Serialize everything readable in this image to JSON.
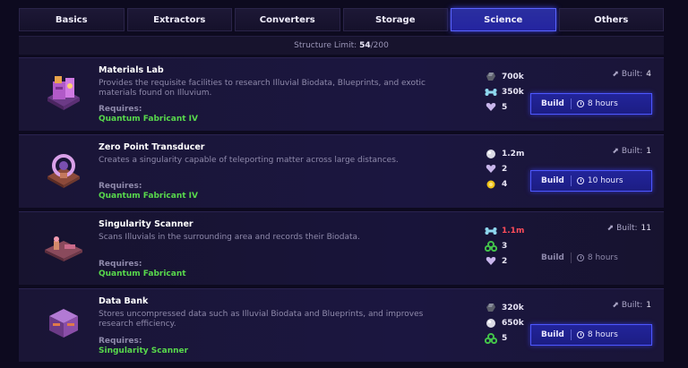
{
  "tabs": [
    {
      "label": "Basics",
      "active": false
    },
    {
      "label": "Extractors",
      "active": false
    },
    {
      "label": "Converters",
      "active": false
    },
    {
      "label": "Storage",
      "active": false
    },
    {
      "label": "Science",
      "active": true
    },
    {
      "label": "Others",
      "active": false
    }
  ],
  "limit": {
    "label": "Structure Limit:",
    "current": "54",
    "max": "/200"
  },
  "colors": {
    "accent": "#4d57ff",
    "requires_value": "#58d84c",
    "insufficient": "#ff4d5a"
  },
  "structures": [
    {
      "title": "Materials Lab",
      "icon": "materials-lab-icon",
      "description": "Provides the requisite facilities to research Illuvial Biodata, Blueprints, and exotic materials found on Illuvium.",
      "requires_label": "Requires:",
      "requires": "Quantum Fabricant IV",
      "costs": [
        {
          "icon": "ore-icon",
          "value": "700k"
        },
        {
          "icon": "bone-icon",
          "value": "350k"
        },
        {
          "icon": "heart-crystal-icon",
          "value": "5"
        }
      ],
      "built_label": "Built:",
      "built": "4",
      "build_label": "Build",
      "time": "8 hours",
      "enabled": true
    },
    {
      "title": "Zero Point Transducer",
      "icon": "transducer-icon",
      "description": "Creates a singularity capable of teleporting matter across large distances.",
      "requires_label": "Requires:",
      "requires": "Quantum Fabricant IV",
      "costs": [
        {
          "icon": "sphere-icon",
          "value": "1.2m"
        },
        {
          "icon": "heart-crystal-icon",
          "value": "2"
        },
        {
          "icon": "gold-coin-icon",
          "value": "4"
        }
      ],
      "built_label": "Built:",
      "built": "1",
      "build_label": "Build",
      "time": "10 hours",
      "enabled": true
    },
    {
      "title": "Singularity Scanner",
      "icon": "scanner-icon",
      "description": "Scans Illuvials in the surrounding area and records their Biodata.",
      "requires_label": "Requires:",
      "requires": "Quantum Fabricant",
      "costs": [
        {
          "icon": "bone-icon",
          "value": "1.1m",
          "insufficient": true
        },
        {
          "icon": "green-cluster-icon",
          "value": "3"
        },
        {
          "icon": "heart-crystal-icon",
          "value": "2"
        }
      ],
      "built_label": "Built:",
      "built": "11",
      "build_label": "Build",
      "time": "8 hours",
      "enabled": false
    },
    {
      "title": "Data Bank",
      "icon": "data-bank-icon",
      "description": "Stores uncompressed data such as Illuvial Biodata and Blueprints, and improves research efficiency.",
      "requires_label": "Requires:",
      "requires": "Singularity Scanner",
      "costs": [
        {
          "icon": "ore-icon",
          "value": "320k"
        },
        {
          "icon": "sphere-icon",
          "value": "650k"
        },
        {
          "icon": "green-cluster-icon",
          "value": "5"
        }
      ],
      "built_label": "Built:",
      "built": "1",
      "build_label": "Build",
      "time": "8 hours",
      "enabled": true
    }
  ]
}
